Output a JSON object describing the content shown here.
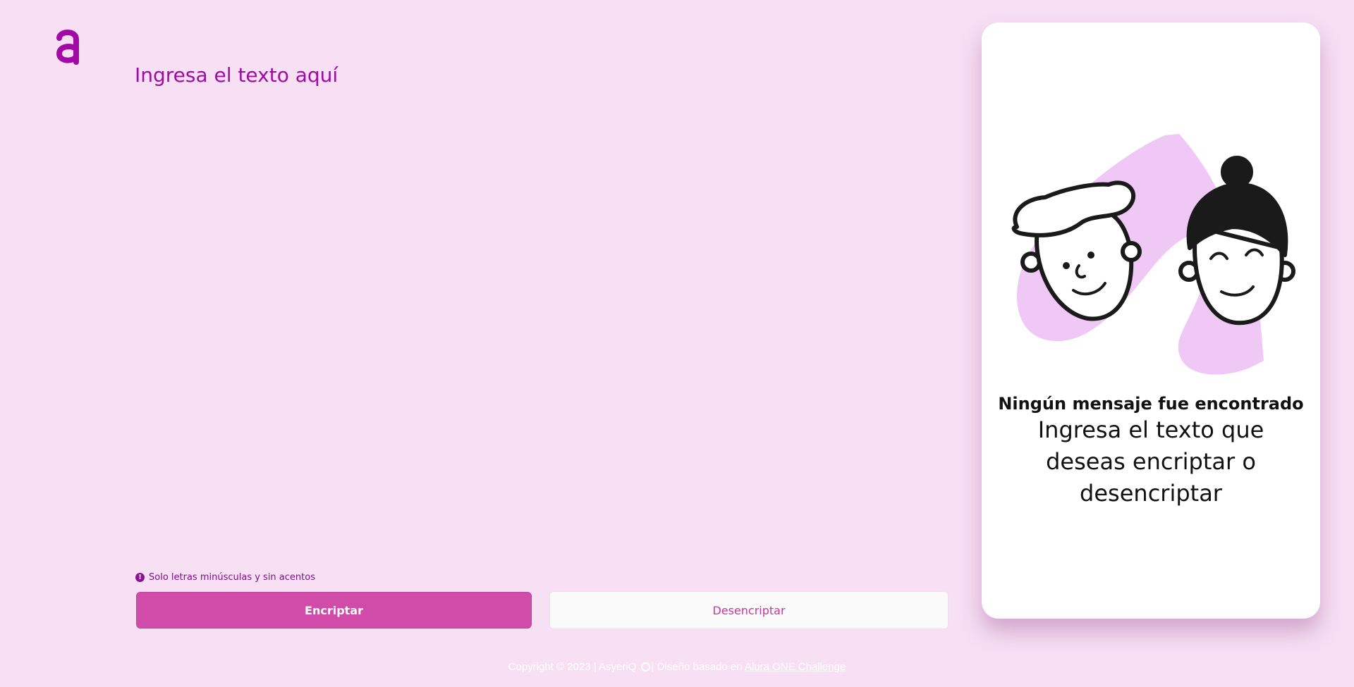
{
  "logo": {
    "icon": "alura-logo-icon",
    "color": "#a10aa5"
  },
  "input": {
    "placeholder": "Ingresa el texto aquí",
    "value": ""
  },
  "hint": {
    "icon": "info-icon",
    "text": "Solo letras minúsculas y sin acentos"
  },
  "buttons": {
    "encrypt_label": "Encriptar",
    "decrypt_label": "Desencriptar"
  },
  "panel": {
    "illustration": "two-faces-illustration",
    "title": "Ningún mensaje fue encontrado",
    "subtitle": "Ingresa el texto que deseas encriptar o desencriptar"
  },
  "footer": {
    "text_before": "Copyright © 2023 | AsyeriQ",
    "icon": "github-icon",
    "text_after": "| Diseño basado en",
    "link_label": "Alura ONE Challenge"
  },
  "colors": {
    "background": "#f7dff4",
    "accent": "#a10aa5",
    "primary_button": "#d04ca8"
  }
}
